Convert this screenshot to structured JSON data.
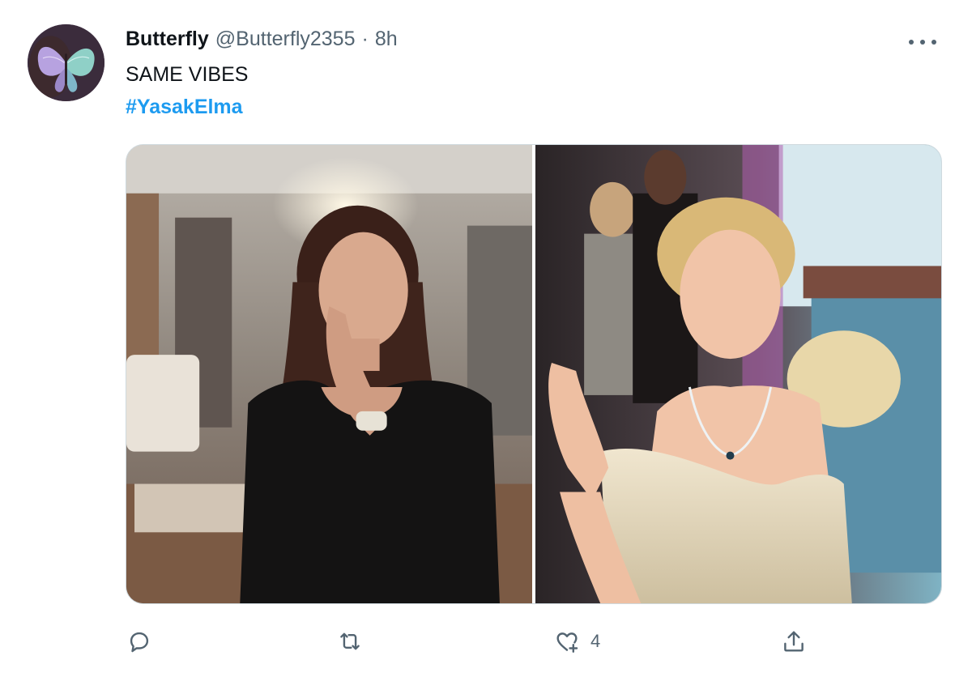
{
  "tweet": {
    "display_name": "Butterfly",
    "handle": "@Butterfly2355",
    "separator": "·",
    "time": "8h",
    "text": "SAME VIBES",
    "hashtag": "#YasakElma",
    "media": [
      {
        "description": "photo-left"
      },
      {
        "description": "photo-right"
      }
    ],
    "actions": {
      "reply_icon": "reply-icon",
      "retweet_icon": "retweet-icon",
      "like_icon": "like-icon",
      "like_count": "4",
      "share_icon": "share-icon"
    },
    "colors": {
      "link": "#1d9bf0",
      "secondary_text": "#536471",
      "primary_text": "#0f1419"
    }
  }
}
